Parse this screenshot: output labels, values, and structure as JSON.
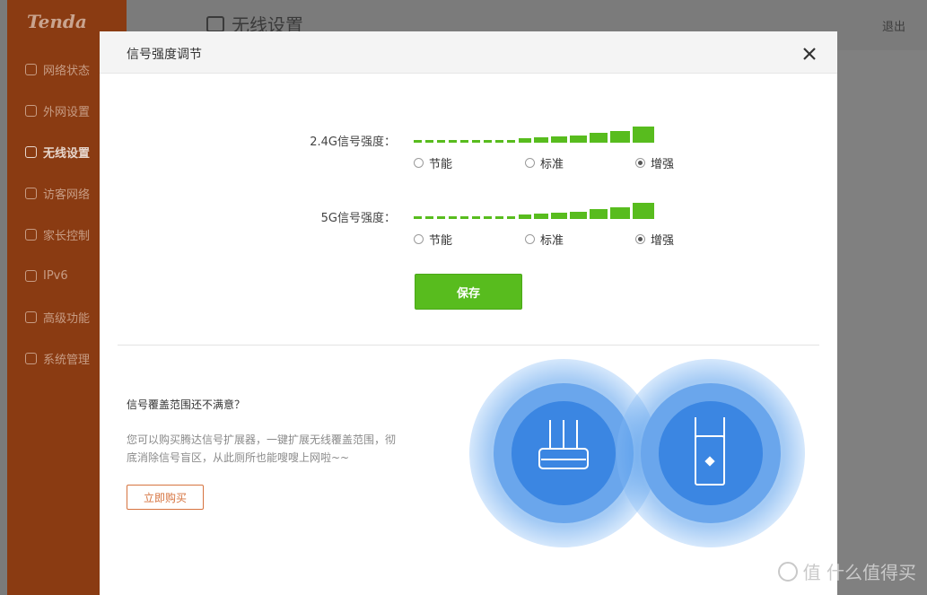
{
  "app": {
    "logo": "Tenda",
    "page_title": "无线设置",
    "logout": "退出",
    "nav": [
      {
        "label": "网络状态",
        "icon": "globe-icon",
        "active": false
      },
      {
        "label": "外网设置",
        "icon": "network-icon",
        "active": false
      },
      {
        "label": "无线设置",
        "icon": "wifi-icon",
        "active": true
      },
      {
        "label": "访客网络",
        "icon": "guest-icon",
        "active": false
      },
      {
        "label": "家长控制",
        "icon": "parental-icon",
        "active": false
      },
      {
        "label": "IPv6",
        "icon": "ipv6-icon",
        "active": false
      },
      {
        "label": "高级功能",
        "icon": "grid-icon",
        "active": false
      },
      {
        "label": "系统管理",
        "icon": "settings-icon",
        "active": false
      }
    ]
  },
  "modal": {
    "title": "信号强度调节",
    "rows": [
      {
        "label": "2.4G信号强度：",
        "options": [
          "节能",
          "标准",
          "增强"
        ],
        "selected": "增强"
      },
      {
        "label": "5G信号强度：",
        "options": [
          "节能",
          "标准",
          "增强"
        ],
        "selected": "增强"
      }
    ],
    "save_label": "保存",
    "promo": {
      "question": "信号覆盖范围还不满意？",
      "text": "您可以购买腾达信号扩展器，一键扩展无线覆盖范围，彻底消除信号盲区，从此厕所也能嗖嗖上网啦~~",
      "buy_label": "立即购买"
    }
  },
  "watermark": "值 什么值得买",
  "colors": {
    "accent_green": "#58bc1e",
    "sidebar": "#8a3b12",
    "buy_border": "#d6733f",
    "circle_blue": "#3b86e2"
  }
}
